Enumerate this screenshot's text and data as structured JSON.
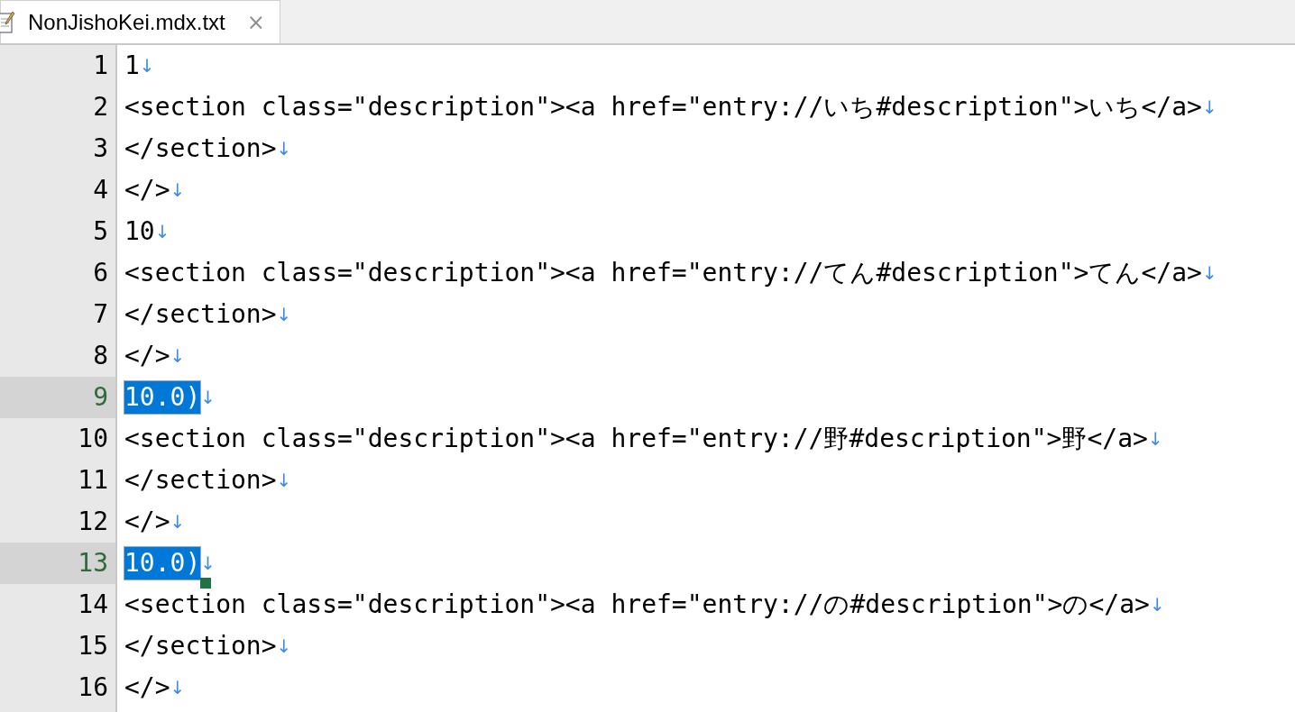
{
  "tab": {
    "title": "NonJishoKei.mdx.txt",
    "close": "×",
    "selected": true
  },
  "lines": [
    {
      "number": "1",
      "text": "1",
      "eol": "↓",
      "selected": false,
      "cursor": false
    },
    {
      "number": "2",
      "text": "<section class=\"description\"><a href=\"entry://いち#description\">いち</a>",
      "eol": "↓",
      "selected": false,
      "cursor": false
    },
    {
      "number": "3",
      "text": "</section>",
      "eol": "↓",
      "selected": false,
      "cursor": false
    },
    {
      "number": "4",
      "text": "</>",
      "eol": "↓",
      "selected": false,
      "cursor": false
    },
    {
      "number": "5",
      "text": "10",
      "eol": "↓",
      "selected": false,
      "cursor": false
    },
    {
      "number": "6",
      "text": "<section class=\"description\"><a href=\"entry://てん#description\">てん</a>",
      "eol": "↓",
      "selected": false,
      "cursor": false
    },
    {
      "number": "7",
      "text": "</section>",
      "eol": "↓",
      "selected": false,
      "cursor": false
    },
    {
      "number": "8",
      "text": "</>",
      "eol": "↓",
      "selected": false,
      "cursor": false
    },
    {
      "number": "9",
      "text": "10.0)",
      "eol": "↓",
      "selected": true,
      "cursor": false
    },
    {
      "number": "10",
      "text": "<section class=\"description\"><a href=\"entry://野#description\">野</a>",
      "eol": "↓",
      "selected": false,
      "cursor": false
    },
    {
      "number": "11",
      "text": "</section>",
      "eol": "↓",
      "selected": false,
      "cursor": false
    },
    {
      "number": "12",
      "text": "</>",
      "eol": "↓",
      "selected": false,
      "cursor": false
    },
    {
      "number": "13",
      "text": "10.0)",
      "eol": "↓",
      "selected": true,
      "cursor": true
    },
    {
      "number": "14",
      "text": "<section class=\"description\"><a href=\"entry://の#description\">の</a>",
      "eol": "↓",
      "selected": false,
      "cursor": false
    },
    {
      "number": "15",
      "text": "</section>",
      "eol": "↓",
      "selected": false,
      "cursor": false
    },
    {
      "number": "16",
      "text": "</>",
      "eol": "↓",
      "selected": false,
      "cursor": false
    }
  ]
}
